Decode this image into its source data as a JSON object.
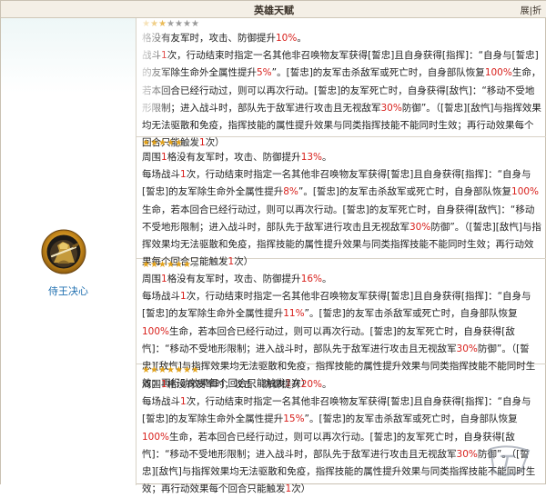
{
  "header": {
    "title": "英雄天赋",
    "toggle_label": "展|折"
  },
  "hero": {
    "name": "侍王决心",
    "icon": "sword-guardian-icon"
  },
  "colors": {
    "highlight": "#d8201c",
    "star_gold": "#e3a21a",
    "star_grey": "#9a9a9a",
    "link": "#1f6fb0"
  },
  "levels": [
    {
      "stars_filled": 3,
      "stars_total": 7,
      "text": [
        [
          "格没有友军时，攻击、防御提升",
          {
            "h": "10%"
          },
          "。"
        ],
        [
          "战斗",
          {
            "h": "1"
          },
          "次，行动结束时指定一名其他非召唤物友军获得[誓忠]且自身获得[指挥]：“自身与[誓忠]的友军除生命外全属性提升",
          {
            "h": "5%"
          },
          "”。[誓忠]的友军击杀敌军或死亡时，自身部队恢复",
          {
            "h": "100%"
          },
          "生命，若本回合已经行动过，则可以再次行动。[誓忠]的友军死亡时，自身获得[敌忾]：“移动不受地形限制；进入战斗时，部队先于敌军进行攻击且无视敌军",
          {
            "h": "30%"
          },
          "防御”。（[誓忠][敌忾]与指挥效果均无法驱散和免疫，指挥技能的属性提升效果与同类指挥技能不能同时生效；再行动效果每个回合只能触发",
          {
            "h": "1"
          },
          "次）"
        ]
      ]
    },
    {
      "stars_filled": 5,
      "stars_total": 7,
      "text": [
        [
          "周围",
          {
            "h": "1"
          },
          "格没有友军时，攻击、防御提升",
          {
            "h": "13%"
          },
          "。"
        ],
        [
          "每场战斗",
          {
            "h": "1"
          },
          "次，行动结束时指定一名其他非召唤物友军获得[誓忠]且自身获得[指挥]：“自身与[誓忠]的友军除生命外全属性提升",
          {
            "h": "8%"
          },
          "”。[誓忠]的友军击杀敌军或死亡时，自身部队恢复",
          {
            "h": "100%"
          },
          "生命，若本回合已经行动过，则可以再次行动。[誓忠]的友军死亡时，自身获得[敌忾]：“移动不受地形限制；进入战斗时，部队先于敌军进行攻击且无视敌军",
          {
            "h": "30%"
          },
          "防御”。（[誓忠][敌忾]与指挥效果均无法驱散和免疫，指挥技能的属性提升效果与同类指挥技能不能同时生效；再行动效果每个回合只能触发",
          {
            "h": "1"
          },
          "次）"
        ]
      ]
    },
    {
      "stars_filled": 6,
      "stars_total": 7,
      "text": [
        [
          "周围",
          {
            "h": "1"
          },
          "格没有友军时，攻击、防御提升",
          {
            "h": "16%"
          },
          "。"
        ],
        [
          "每场战斗",
          {
            "h": "1"
          },
          "次，行动结束时指定一名其他非召唤物友军获得[誓忠]且自身获得[指挥]：“自身与[誓忠]的友军除生命外全属性提升",
          {
            "h": "11%"
          },
          "”。[誓忠]的友军击杀敌军或死亡时，自身部队恢复",
          {
            "h": "100%"
          },
          "生命，若本回合已经行动过，则可以再次行动。[誓忠]的友军死亡时，自身获得[敌忾]：“移动不受地形限制；进入战斗时，部队先于敌军进行攻击且无视敌军",
          {
            "h": "30%"
          },
          "防御”。（[誓忠][敌忾]与指挥效果均无法驱散和免疫，指挥技能的属性提升效果与同类指挥技能不能同时生效；再行动效果每个回合只能触发",
          {
            "h": "1"
          },
          "次）"
        ]
      ]
    },
    {
      "stars_filled": 7,
      "stars_total": 7,
      "text": [
        [
          "周围",
          {
            "h": "1"
          },
          "格没有友军时，攻击、防御提升",
          {
            "h": "20%"
          },
          "。"
        ],
        [
          "每场战斗",
          {
            "h": "1"
          },
          "次，行动结束时指定一名其他非召唤物友军获得[誓忠]且自身获得[指挥]：“自身与[誓忠]的友军除生命外全属性提升",
          {
            "h": "15%"
          },
          "”。[誓忠]的友军击杀敌军或死亡时，自身部队恢复",
          {
            "h": "100%"
          },
          "生命，若本回合已经行动过，则可以再次行动。[誓忠]的友军死亡时，自身获得[敌忾]：“移动不受地形限制；进入战斗时，部队先于敌军进行攻击且无视敌军",
          {
            "h": "30%"
          },
          "防御”。（[誓忠][敌忾]与指挥效果均无法驱散和免疫，指挥技能的属性提升效果与同类指挥技能不能同时生效；再行动效果每个回合只能触发",
          {
            "h": "1"
          },
          "次）"
        ]
      ]
    }
  ]
}
